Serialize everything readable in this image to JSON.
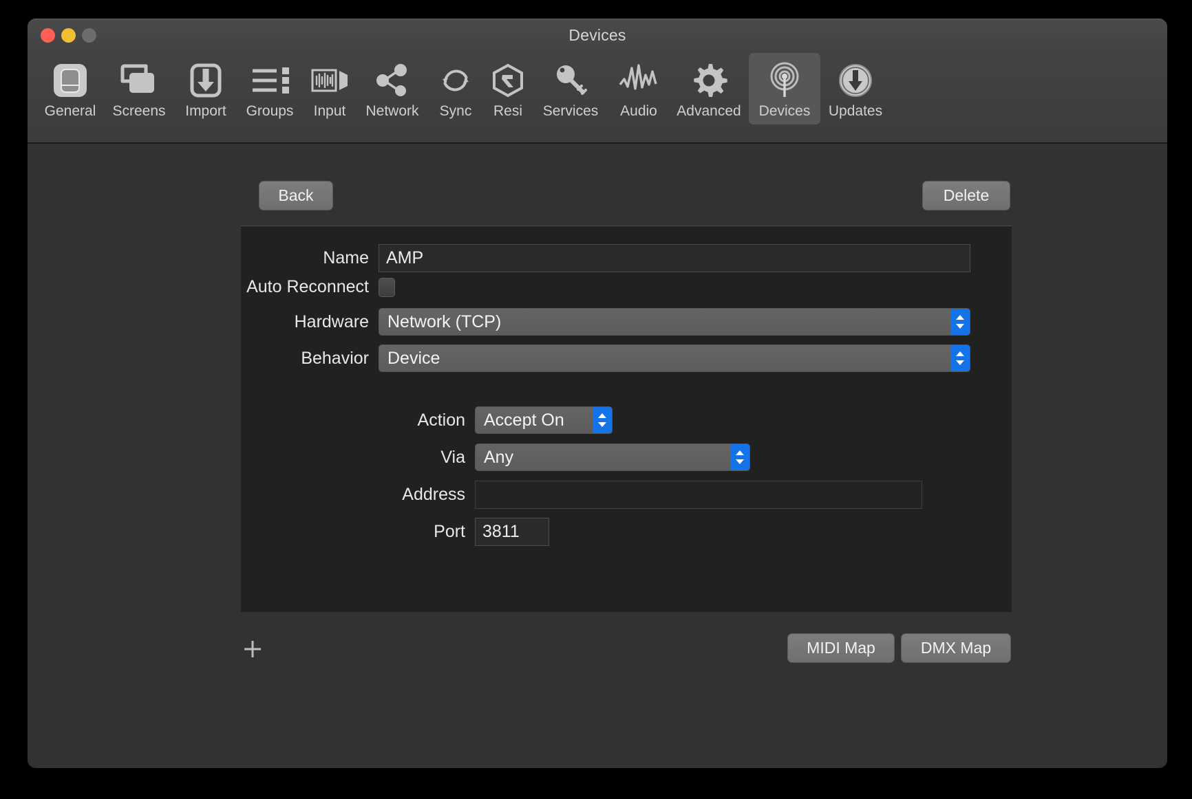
{
  "window": {
    "title": "Devices",
    "traffic_lights": [
      "close",
      "minimize",
      "zoom"
    ]
  },
  "toolbar": {
    "items": [
      {
        "label": "General",
        "icon": "general-icon",
        "selected": false
      },
      {
        "label": "Screens",
        "icon": "screens-icon",
        "selected": false
      },
      {
        "label": "Import",
        "icon": "import-icon",
        "selected": false
      },
      {
        "label": "Groups",
        "icon": "groups-icon",
        "selected": false
      },
      {
        "label": "Input",
        "icon": "input-icon",
        "selected": false
      },
      {
        "label": "Network",
        "icon": "network-icon",
        "selected": false
      },
      {
        "label": "Sync",
        "icon": "sync-icon",
        "selected": false
      },
      {
        "label": "Resi",
        "icon": "resi-icon",
        "selected": false
      },
      {
        "label": "Services",
        "icon": "services-key-icon",
        "selected": false
      },
      {
        "label": "Audio",
        "icon": "audio-waveform-icon",
        "selected": false
      },
      {
        "label": "Advanced",
        "icon": "gear-icon",
        "selected": false
      },
      {
        "label": "Devices",
        "icon": "broadcast-icon",
        "selected": true
      },
      {
        "label": "Updates",
        "icon": "download-circle-icon",
        "selected": false
      }
    ]
  },
  "actions": {
    "back_label": "Back",
    "delete_label": "Delete"
  },
  "form": {
    "name": {
      "label": "Name",
      "value": "AMP",
      "placeholder": ""
    },
    "auto_reconnect": {
      "label": "Auto Reconnect",
      "checked": false
    },
    "hardware": {
      "label": "Hardware",
      "value": "Network (TCP)"
    },
    "behavior": {
      "label": "Behavior",
      "value": "Device"
    },
    "action": {
      "label": "Action",
      "value": "Accept On"
    },
    "via": {
      "label": "Via",
      "value": "Any"
    },
    "address": {
      "label": "Address",
      "value": "",
      "placeholder": ""
    },
    "port": {
      "label": "Port",
      "value": "3811",
      "placeholder": ""
    }
  },
  "footer": {
    "add_label": "+",
    "midi_map_label": "MIDI Map",
    "dmx_map_label": "DMX Map"
  },
  "colors": {
    "window_bg": "#323232",
    "panel_bg": "#212121",
    "titlebar_bg": "#454545",
    "accent_blue": "#1473e6",
    "selected_tab_bg": "#575757",
    "text": "#e8e8e8",
    "close": "#ff5f57",
    "minimize": "#f0bf35",
    "zoom": "#6d6d6d"
  }
}
